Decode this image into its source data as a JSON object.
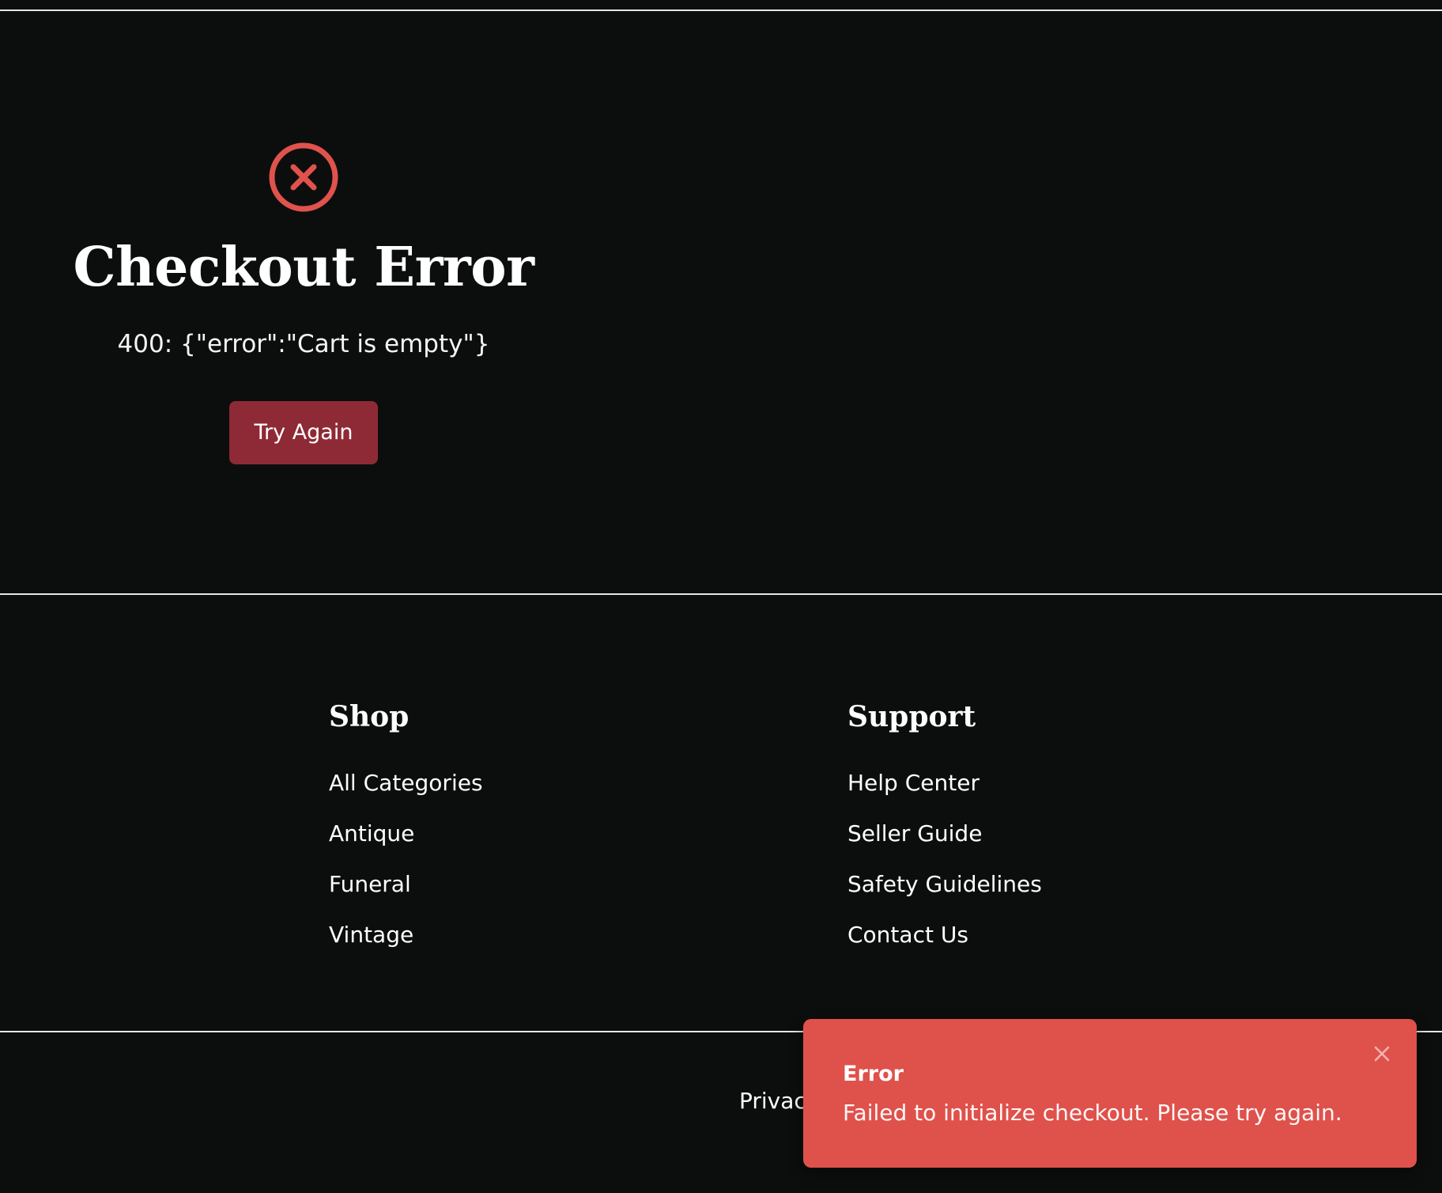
{
  "colors": {
    "background": "#0c0e0e",
    "error_icon": "#e0524c",
    "button": "#8e2a35",
    "toast": "#df514b",
    "text": "#ffffff"
  },
  "error": {
    "icon": "x-circle-icon",
    "title": "Checkout Error",
    "message": "400: {\"error\":\"Cart is empty\"}",
    "button_label": "Try Again"
  },
  "footer": {
    "shop": {
      "heading": "Shop",
      "links": [
        "All Categories",
        "Antique",
        "Funeral",
        "Vintage"
      ]
    },
    "support": {
      "heading": "Support",
      "links": [
        "Help Center",
        "Seller Guide",
        "Safety Guidelines",
        "Contact Us"
      ]
    },
    "bottom_link": "Privac"
  },
  "toast": {
    "title": "Error",
    "message": "Failed to initialize checkout. Please try again.",
    "close_icon": "close-icon"
  }
}
